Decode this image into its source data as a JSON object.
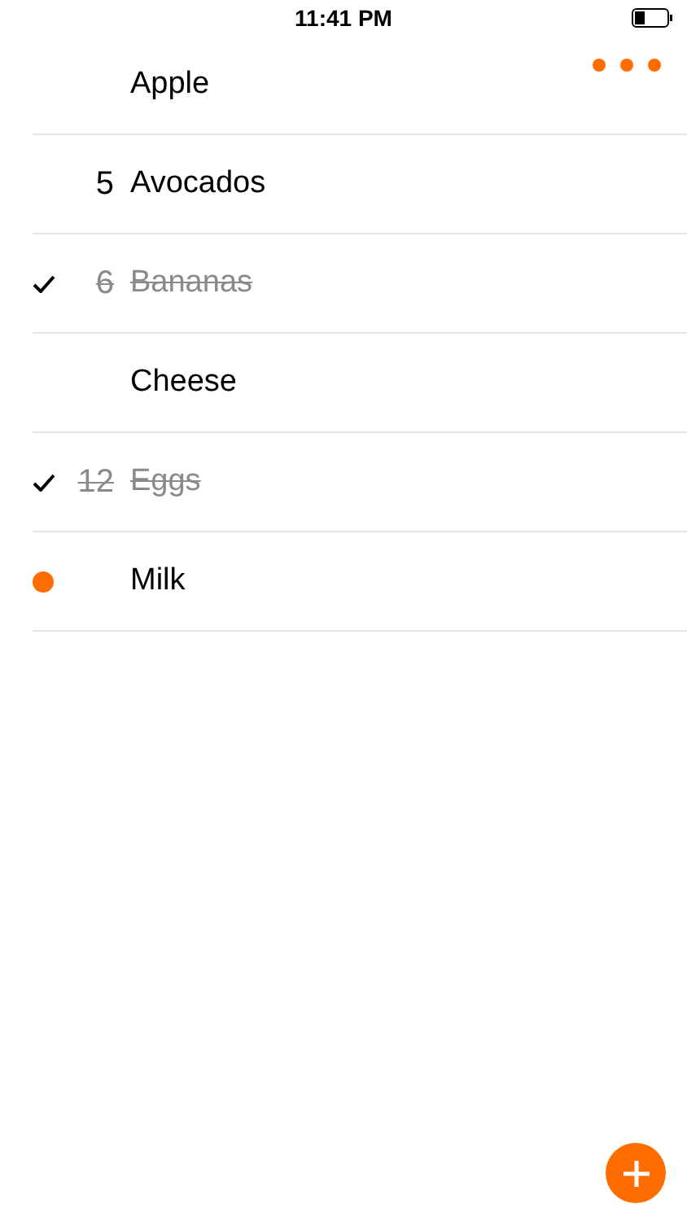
{
  "status_bar": {
    "time": "11:41 PM"
  },
  "items": [
    {
      "name": "Apple",
      "checked": false,
      "flagged": false
    },
    {
      "quantity": "5",
      "name": "Avocados",
      "checked": false,
      "flagged": false
    },
    {
      "quantity": "6",
      "name": "Bananas",
      "checked": true,
      "flagged": false
    },
    {
      "name": "Cheese",
      "checked": false,
      "flagged": false
    },
    {
      "quantity": "12",
      "name": "Eggs",
      "checked": true,
      "flagged": false
    },
    {
      "name": "Milk",
      "checked": false,
      "flagged": true
    }
  ]
}
